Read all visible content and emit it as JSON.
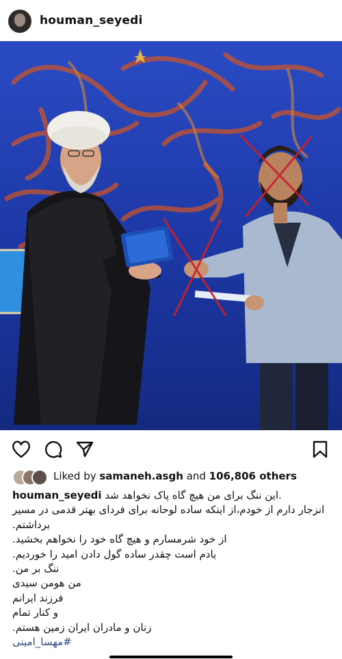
{
  "post": {
    "username": "houman_seyedi"
  },
  "likes": {
    "text_prefix": "Liked by",
    "first_liker": "samaneh.asgh",
    "and_text": "and",
    "others_text": "106,806 others"
  },
  "caption": {
    "author": "houman_seyedi",
    "first_line_text": ".این ننگ برای من هیچ گاه پاک نخواهد شد",
    "lines": [
      "انزجار دارم از خودم،از اینکه ساده لوحانه برای فردای بهتر قدمی در مسیر",
      "برداشتم.",
      "از خود شرمسارم و هیچ گاه خود را نخواهم بخشید.",
      "یادم است چقدر ساده گول دادن امید را خوردیم.",
      "ننگ بر من.",
      "من هومن سیدی",
      "فرزند ایرانم",
      "و کنار تمام",
      "زنان و مادران ایران زمین هستم."
    ],
    "hashtag": "#مهسا_امینی"
  },
  "icons": {
    "like": "heart-icon",
    "comment": "comment-icon",
    "share": "share-icon",
    "save": "bookmark-icon"
  }
}
